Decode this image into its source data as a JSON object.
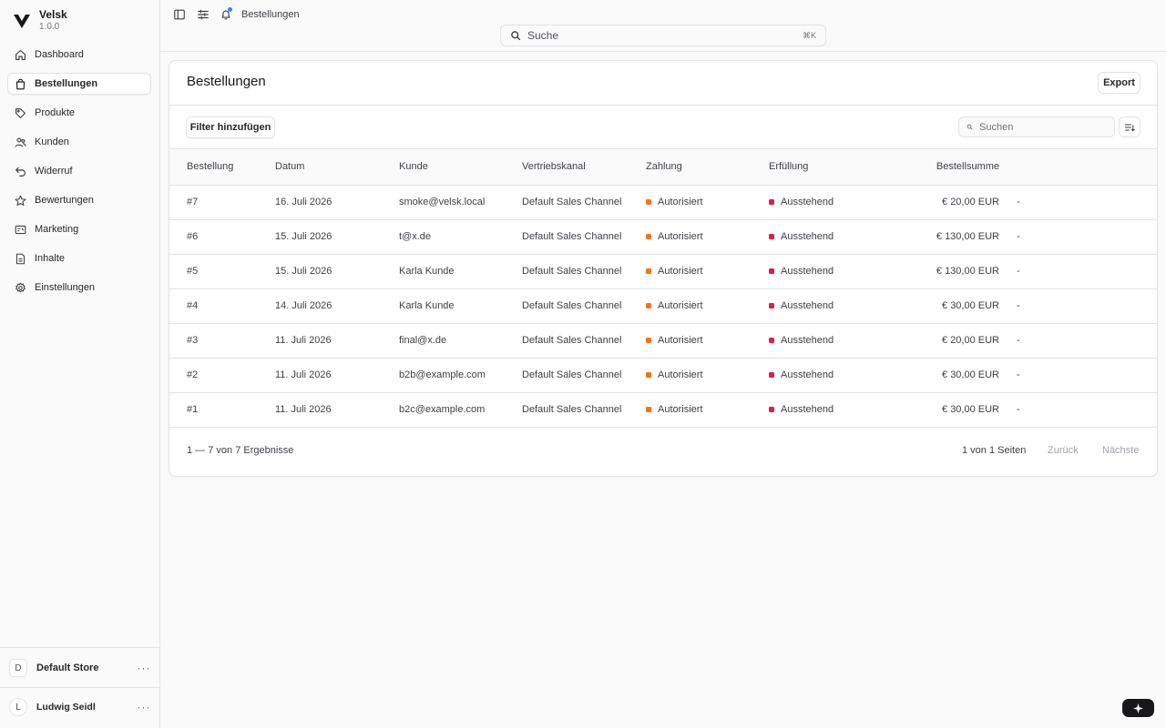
{
  "brand": {
    "name": "Velsk",
    "version": "1.0.0"
  },
  "nav": {
    "items": [
      {
        "label": "Dashboard",
        "icon": "home-icon"
      },
      {
        "label": "Bestellungen",
        "icon": "shopping-bag-icon",
        "active": true
      },
      {
        "label": "Produkte",
        "icon": "tag-icon"
      },
      {
        "label": "Kunden",
        "icon": "users-icon"
      },
      {
        "label": "Widerruf",
        "icon": "undo-icon"
      },
      {
        "label": "Bewertungen",
        "icon": "star-icon"
      },
      {
        "label": "Marketing",
        "icon": "receipt-icon"
      },
      {
        "label": "Inhalte",
        "icon": "document-icon"
      },
      {
        "label": "Einstellungen",
        "icon": "cog-icon"
      }
    ]
  },
  "store": {
    "badge": "D",
    "name": "Default Store",
    "more": "···"
  },
  "user": {
    "badge": "L",
    "name": "Ludwig Seidl",
    "more": "···"
  },
  "topbar": {
    "breadcrumb": "Bestellungen"
  },
  "global_search": {
    "placeholder": "Suche",
    "shortcut": "⌘K"
  },
  "page": {
    "title": "Bestellungen",
    "export_label": "Export",
    "filter_label": "Filter hinzufügen",
    "search_placeholder": "Suchen"
  },
  "table": {
    "columns": [
      "Bestellung",
      "Datum",
      "Kunde",
      "Vertriebskanal",
      "Zahlung",
      "Erfüllung",
      "Bestellsumme"
    ],
    "rows": [
      {
        "order": "#7",
        "date": "16. Juli 2026",
        "customer": "smoke@velsk.local",
        "channel": "Default Sales Channel",
        "payment": "Autorisiert",
        "fulfillment": "Ausstehend",
        "total": "€ 20,00 EUR",
        "extra": "-"
      },
      {
        "order": "#6",
        "date": "15. Juli 2026",
        "customer": "t@x.de",
        "channel": "Default Sales Channel",
        "payment": "Autorisiert",
        "fulfillment": "Ausstehend",
        "total": "€ 130,00 EUR",
        "extra": "-"
      },
      {
        "order": "#5",
        "date": "15. Juli 2026",
        "customer": "Karla Kunde",
        "channel": "Default Sales Channel",
        "payment": "Autorisiert",
        "fulfillment": "Ausstehend",
        "total": "€ 130,00 EUR",
        "extra": "-"
      },
      {
        "order": "#4",
        "date": "14. Juli 2026",
        "customer": "Karla Kunde",
        "channel": "Default Sales Channel",
        "payment": "Autorisiert",
        "fulfillment": "Ausstehend",
        "total": "€ 30,00 EUR",
        "extra": "-"
      },
      {
        "order": "#3",
        "date": "11. Juli 2026",
        "customer": "final@x.de",
        "channel": "Default Sales Channel",
        "payment": "Autorisiert",
        "fulfillment": "Ausstehend",
        "total": "€ 20,00 EUR",
        "extra": "-"
      },
      {
        "order": "#2",
        "date": "11. Juli 2026",
        "customer": "b2b@example.com",
        "channel": "Default Sales Channel",
        "payment": "Autorisiert",
        "fulfillment": "Ausstehend",
        "total": "€ 30,00 EUR",
        "extra": "-"
      },
      {
        "order": "#1",
        "date": "11. Juli 2026",
        "customer": "b2c@example.com",
        "channel": "Default Sales Channel",
        "payment": "Autorisiert",
        "fulfillment": "Ausstehend",
        "total": "€ 30,00 EUR",
        "extra": "-"
      }
    ]
  },
  "colors": {
    "payment_status": "#f97316",
    "fulfillment_status": "#e11d48"
  },
  "footer": {
    "range": "1 — 7 von 7 Ergebnisse",
    "pages": "1 von 1 Seiten",
    "prev": "Zurück",
    "next": "Nächste"
  }
}
